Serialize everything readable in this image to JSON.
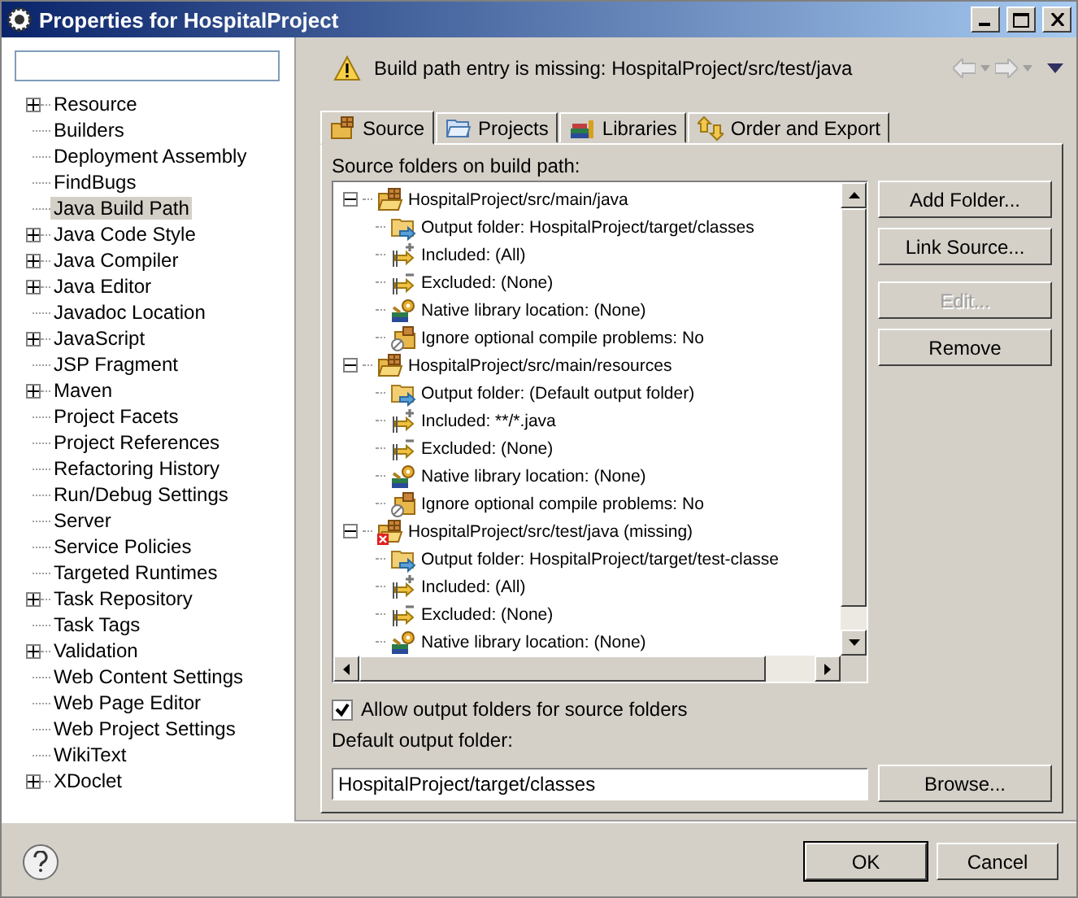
{
  "window": {
    "title": "Properties for HospitalProject"
  },
  "sidebar": {
    "items": [
      {
        "label": "Resource",
        "expandable": true,
        "selected": false
      },
      {
        "label": "Builders",
        "expandable": false,
        "selected": false
      },
      {
        "label": "Deployment Assembly",
        "expandable": false,
        "selected": false
      },
      {
        "label": "FindBugs",
        "expandable": false,
        "selected": false
      },
      {
        "label": "Java Build Path",
        "expandable": false,
        "selected": true
      },
      {
        "label": "Java Code Style",
        "expandable": true,
        "selected": false
      },
      {
        "label": "Java Compiler",
        "expandable": true,
        "selected": false
      },
      {
        "label": "Java Editor",
        "expandable": true,
        "selected": false
      },
      {
        "label": "Javadoc Location",
        "expandable": false,
        "selected": false
      },
      {
        "label": "JavaScript",
        "expandable": true,
        "selected": false
      },
      {
        "label": "JSP Fragment",
        "expandable": false,
        "selected": false
      },
      {
        "label": "Maven",
        "expandable": true,
        "selected": false
      },
      {
        "label": "Project Facets",
        "expandable": false,
        "selected": false
      },
      {
        "label": "Project References",
        "expandable": false,
        "selected": false
      },
      {
        "label": "Refactoring History",
        "expandable": false,
        "selected": false
      },
      {
        "label": "Run/Debug Settings",
        "expandable": false,
        "selected": false
      },
      {
        "label": "Server",
        "expandable": false,
        "selected": false
      },
      {
        "label": "Service Policies",
        "expandable": false,
        "selected": false
      },
      {
        "label": "Targeted Runtimes",
        "expandable": false,
        "selected": false
      },
      {
        "label": "Task Repository",
        "expandable": true,
        "selected": false
      },
      {
        "label": "Task Tags",
        "expandable": false,
        "selected": false
      },
      {
        "label": "Validation",
        "expandable": true,
        "selected": false
      },
      {
        "label": "Web Content Settings",
        "expandable": false,
        "selected": false
      },
      {
        "label": "Web Page Editor",
        "expandable": false,
        "selected": false
      },
      {
        "label": "Web Project Settings",
        "expandable": false,
        "selected": false
      },
      {
        "label": "WikiText",
        "expandable": false,
        "selected": false
      },
      {
        "label": "XDoclet",
        "expandable": true,
        "selected": false
      }
    ]
  },
  "message": {
    "kind": "warning",
    "text": "Build path entry is missing: HospitalProject/src/test/java"
  },
  "tabs": [
    {
      "label": "Source",
      "kind": "source",
      "selected": true
    },
    {
      "label": "Projects",
      "kind": "projects",
      "selected": false
    },
    {
      "label": "Libraries",
      "kind": "libraries",
      "selected": false
    },
    {
      "label": "Order and Export",
      "kind": "order",
      "selected": false
    }
  ],
  "source_folders": {
    "label": "Source folders on build path:",
    "folders": [
      {
        "label": "HospitalProject/src/main/java",
        "missing": false,
        "expanded": true,
        "children": [
          {
            "kind": "output",
            "label": "Output folder: HospitalProject/target/classes"
          },
          {
            "kind": "included",
            "label": "Included: (All)"
          },
          {
            "kind": "excluded",
            "label": "Excluded: (None)"
          },
          {
            "kind": "native",
            "label": "Native library location: (None)"
          },
          {
            "kind": "ignore",
            "label": "Ignore optional compile problems: No"
          }
        ]
      },
      {
        "label": "HospitalProject/src/main/resources",
        "missing": false,
        "expanded": true,
        "children": [
          {
            "kind": "output",
            "label": "Output folder: (Default output folder)"
          },
          {
            "kind": "included",
            "label": "Included: **/*.java"
          },
          {
            "kind": "excluded",
            "label": "Excluded: (None)"
          },
          {
            "kind": "native",
            "label": "Native library location: (None)"
          },
          {
            "kind": "ignore",
            "label": "Ignore optional compile problems: No"
          }
        ]
      },
      {
        "label": "HospitalProject/src/test/java (missing)",
        "missing": true,
        "expanded": true,
        "children": [
          {
            "kind": "output",
            "label": "Output folder: HospitalProject/target/test-classe"
          },
          {
            "kind": "included",
            "label": "Included: (All)"
          },
          {
            "kind": "excluded",
            "label": "Excluded: (None)"
          },
          {
            "kind": "native",
            "label": "Native library location: (None)"
          }
        ]
      }
    ]
  },
  "buttons": [
    {
      "label": "Add Folder...",
      "disabled": false
    },
    {
      "label": "Link Source...",
      "disabled": false
    },
    {
      "label": "Edit...",
      "disabled": true
    },
    {
      "label": "Remove",
      "disabled": false
    }
  ],
  "allow_output": {
    "label": "Allow output folders for source folders",
    "checked": true
  },
  "default_output": {
    "label": "Default output folder:",
    "value": "HospitalProject/target/classes",
    "button": "Browse..."
  },
  "footer": {
    "buttons": [
      {
        "label": "OK",
        "default": true
      },
      {
        "label": "Cancel",
        "default": false
      }
    ]
  }
}
